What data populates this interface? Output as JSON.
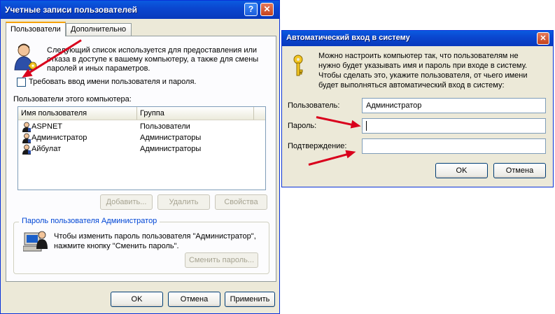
{
  "left_window": {
    "title": "Учетные записи пользователей",
    "tabs": [
      {
        "label": "Пользователи"
      },
      {
        "label": "Дополнительно"
      }
    ],
    "description": [
      "Следующий список используется для предоставления или",
      "отказа в доступе к вашему компьютеру, а также для смены",
      "паролей и иных параметров."
    ],
    "checkbox_label": "Требовать ввод имени пользователя и пароля.",
    "list_label": "Пользователи этого компьютера:",
    "columns": [
      "Имя пользователя",
      "Группа"
    ],
    "users": [
      {
        "name": "ASPNET",
        "group": "Пользователи"
      },
      {
        "name": "Администратор",
        "group": "Администраторы"
      },
      {
        "name": "Айбулат",
        "group": "Администраторы"
      }
    ],
    "add_button": "Добавить...",
    "remove_button": "Удалить",
    "properties_button": "Свойства",
    "password_group_title": "Пароль пользователя Администратор",
    "password_text": [
      "Чтобы изменить пароль пользователя \"Администратор\",",
      "нажмите кнопку \"Сменить пароль\"."
    ],
    "change_password_button": "Сменить пароль...",
    "ok_button": "OK",
    "cancel_button": "Отмена",
    "apply_button": "Применить"
  },
  "right_window": {
    "title": "Автоматический вход в систему",
    "description": [
      "Можно настроить компьютер так, что пользователям не",
      "нужно будет указывать имя и пароль при входе в систему.",
      "Чтобы сделать это, укажите пользователя, от чьего имени",
      "будет выполняться автоматический вход в систему:"
    ],
    "user_label": "Пользователь:",
    "user_value": "Администратор",
    "password_label": "Пароль:",
    "password_value": "",
    "confirm_label": "Подтверждение:",
    "confirm_value": "",
    "ok_button": "OK",
    "cancel_button": "Отмена"
  },
  "colors": {
    "titlebar": "#0a47d0",
    "window_face": "#ece9d8",
    "annotation_arrow": "#d9001c"
  }
}
